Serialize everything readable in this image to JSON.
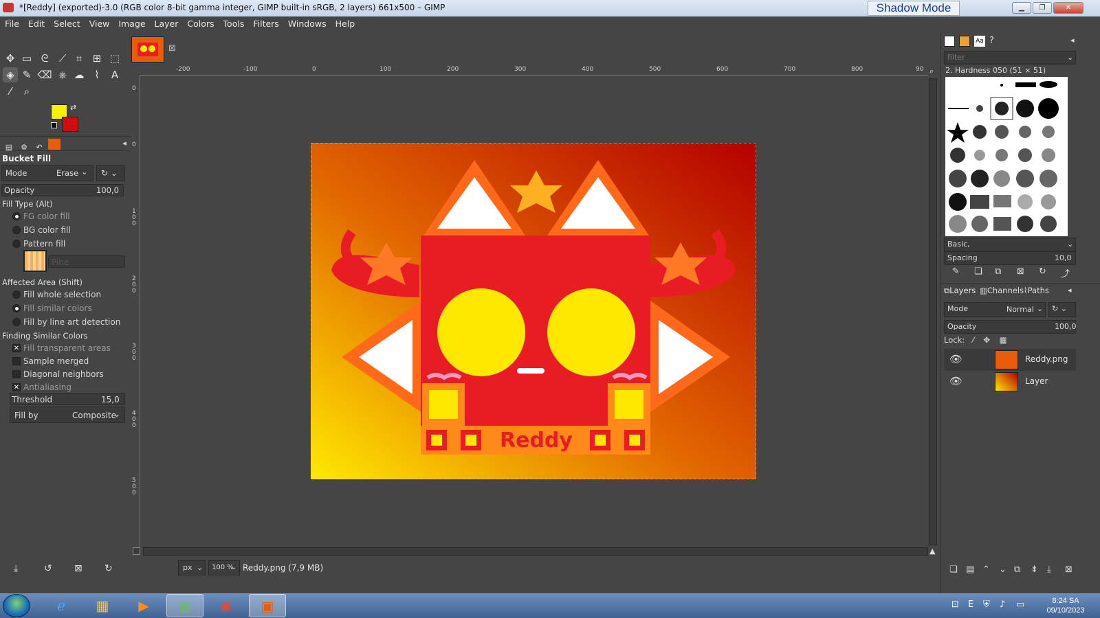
{
  "window": {
    "title": "*[Reddy] (exported)-3.0 (RGB color 8-bit gamma integer, GIMP built-in sRGB, 2 layers) 661x500 – GIMP",
    "shadow_mode": "Shadow Mode"
  },
  "menu": [
    "File",
    "Edit",
    "Select",
    "View",
    "Image",
    "Layer",
    "Colors",
    "Tools",
    "Filters",
    "Windows",
    "Help"
  ],
  "colors": {
    "fg": "#f9f008",
    "bg": "#d00d0d",
    "accent": "#e85d0c"
  },
  "tool_options": {
    "title": "Bucket Fill",
    "mode_label": "Mode",
    "mode_value": "Erase",
    "opacity_label": "Opacity",
    "opacity_value": "100,0",
    "fill_type_label": "Fill Type  (Alt)",
    "fill_types": [
      "FG color fill",
      "BG color fill",
      "Pattern fill"
    ],
    "pattern_name": "Pine",
    "affected_area_label": "Affected Area  (Shift)",
    "areas": [
      "Fill whole selection",
      "Fill similar colors",
      "Fill by line art detection"
    ],
    "finding_label": "Finding Similar Colors",
    "checks": [
      "Fill transparent areas",
      "Sample merged",
      "Diagonal neighbors",
      "Antialiasing"
    ],
    "threshold_label": "Threshold",
    "threshold_value": "15,0",
    "fillby_label": "Fill by",
    "fillby_value": "Composite"
  },
  "ruler": {
    "h": [
      "-200",
      "-100",
      "0",
      "100",
      "200",
      "300",
      "400",
      "500",
      "600",
      "700",
      "800",
      "90"
    ],
    "v": [
      "0",
      "0",
      "1 0 0",
      "2 0 0",
      "3 0 0",
      "4 0 0",
      "5 0 0"
    ]
  },
  "artwork": {
    "caption": "Reddy"
  },
  "status": {
    "unit": "px",
    "zoom": "100 %",
    "text": "Reddy.png (7,9 MB)"
  },
  "brushes": {
    "filter_placeholder": "filter",
    "current": "2. Hardness 050 (51 × 51)",
    "preset": "Basic,",
    "spacing_label": "Spacing",
    "spacing_value": "10,0"
  },
  "layers_panel": {
    "tabs": [
      "Layers",
      "Channels",
      "Paths"
    ],
    "mode_label": "Mode",
    "mode_value": "Normal",
    "opacity_label": "Opacity",
    "opacity_value": "100,0",
    "lock_label": "Lock:",
    "layers": [
      {
        "name": "Reddy.png"
      },
      {
        "name": "Layer"
      }
    ]
  },
  "taskbar": {
    "time": "8:24 SA",
    "date": "09/10/2023"
  }
}
